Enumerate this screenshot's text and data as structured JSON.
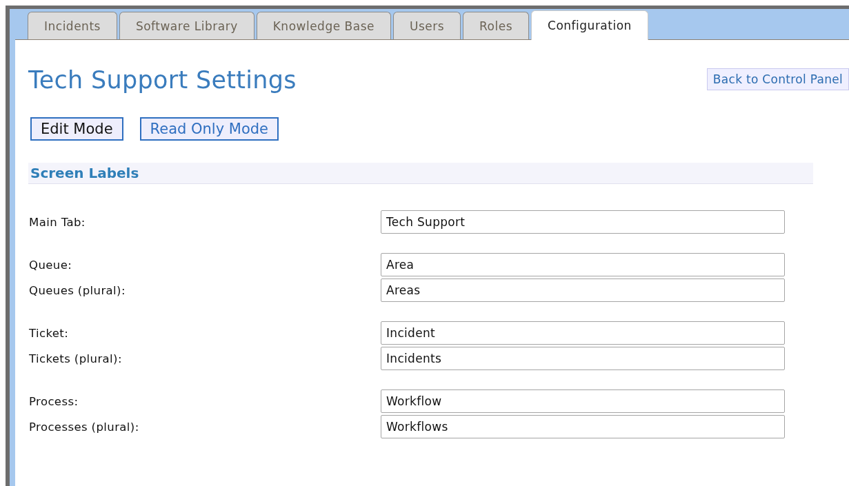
{
  "tabs": [
    {
      "label": "Incidents",
      "selected": false
    },
    {
      "label": "Software Library",
      "selected": false
    },
    {
      "label": "Knowledge Base",
      "selected": false
    },
    {
      "label": "Users",
      "selected": false
    },
    {
      "label": "Roles",
      "selected": false
    },
    {
      "label": "Configuration",
      "selected": true
    }
  ],
  "page_title": "Tech Support Settings",
  "back_link": "Back to Control Panel",
  "mode_buttons": [
    {
      "label": "Edit Mode",
      "selected": true
    },
    {
      "label": "Read Only Mode",
      "selected": false
    }
  ],
  "section": {
    "title": "Screen Labels",
    "groups": [
      [
        {
          "label": "Main Tab:",
          "value": "Tech Support"
        }
      ],
      [
        {
          "label": "Queue:",
          "value": "Area"
        },
        {
          "label": "Queues (plural):",
          "value": "Areas"
        }
      ],
      [
        {
          "label": "Ticket:",
          "value": "Incident"
        },
        {
          "label": "Tickets (plural):",
          "value": "Incidents"
        }
      ],
      [
        {
          "label": "Process:",
          "value": "Workflow"
        },
        {
          "label": "Processes (plural):",
          "value": "Workflows"
        }
      ]
    ]
  }
}
